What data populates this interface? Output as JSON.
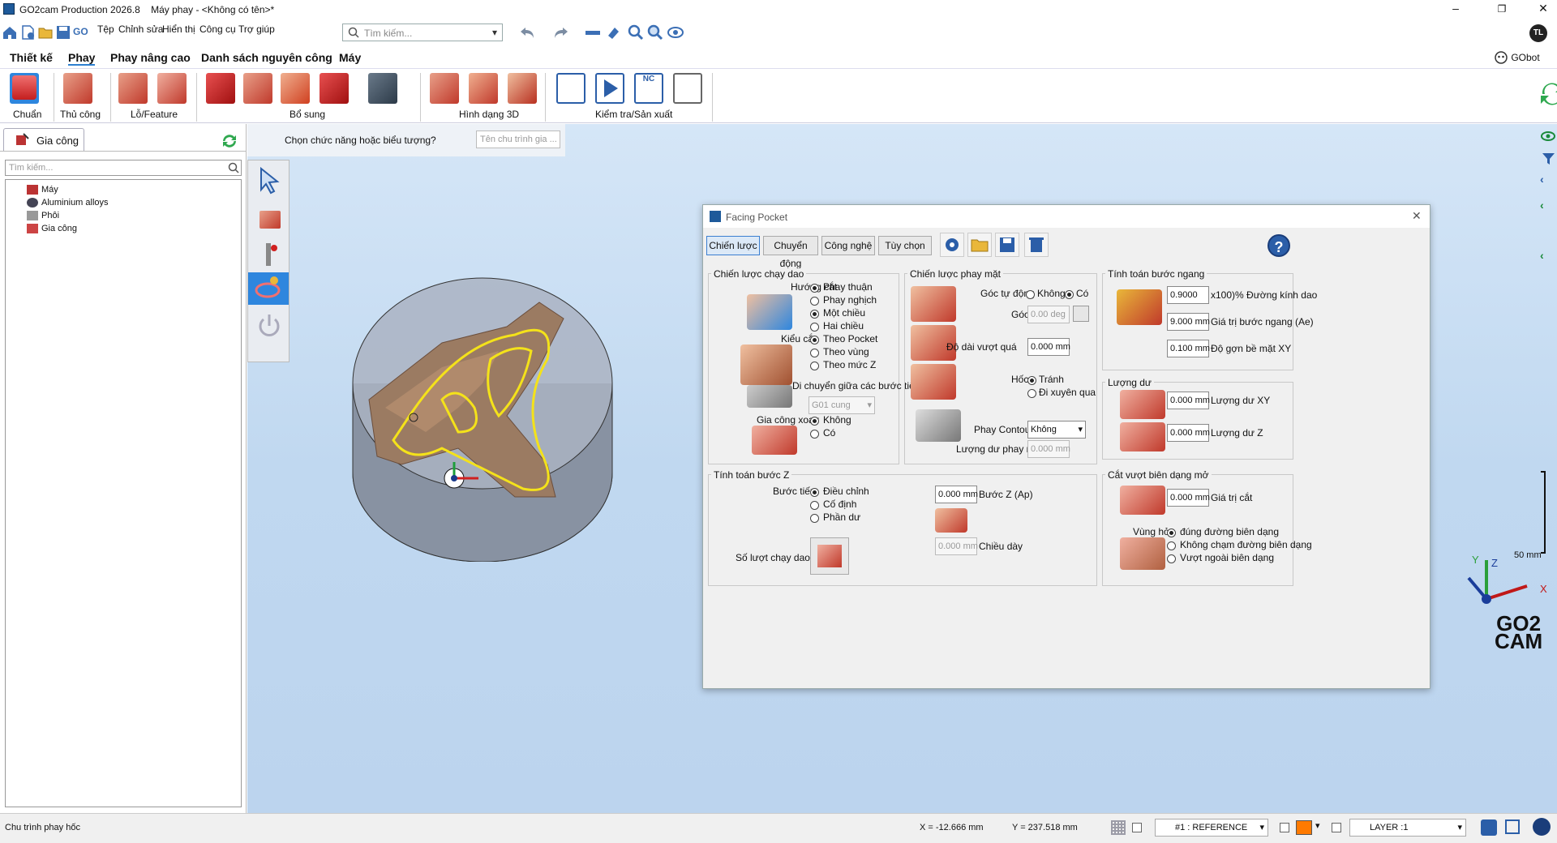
{
  "title_bar": {
    "app": "GO2cam Production 2026.8",
    "doc": "Máy phay - <Không có tên>*",
    "min": "–",
    "max": "❐",
    "close": "✕"
  },
  "menu": [
    "Tệp",
    "Chỉnh sửa",
    "Hiển thị",
    "Công cụ",
    "Trợ giúp"
  ],
  "search": {
    "placeholder": "Tìm kiếm..."
  },
  "user_initials": "TL",
  "go_label": "GO",
  "ribbon_tabs": [
    "Thiết kế",
    "Phay",
    "Phay nâng cao",
    "Danh sách nguyên công",
    "Máy"
  ],
  "gobot": "GObot",
  "ribbon_groups": [
    "Chuẩn",
    "Thủ công",
    "Lỗ/Feature",
    "Bổ sung",
    "Hình dạng 3D",
    "Kiểm tra/Sản xuất"
  ],
  "left_panel": {
    "tab": "Gia công",
    "search_placeholder": "Tìm kiếm...",
    "tree": [
      "Máy",
      "Aluminium alloys",
      "Phôi",
      "Gia công"
    ]
  },
  "hint": {
    "text": "Chọn chức năng hoặc biểu tượng?",
    "input_placeholder": "Tên chu trình gia ..."
  },
  "dialog": {
    "title": "Facing Pocket",
    "tabs": [
      "Chiến lược",
      "Chuyển động",
      "Công nghệ",
      "Tùy chọn"
    ],
    "g1": {
      "title": "Chiến lược chạy dao",
      "huong_cat": "Hướng cắt",
      "r1": [
        "Phay thuận",
        "Phay nghịch"
      ],
      "r2": [
        "Một chiều",
        "Hai chiều"
      ],
      "kieu_cat": "Kiểu cắt",
      "r3": [
        "Theo Pocket",
        "Theo vùng",
        "Theo mức Z"
      ],
      "di_chuyen": "Di chuyển giữa các bước tiến",
      "di_chuyen_val": "G01 cung",
      "gc_xoay": "Gia công xoay",
      "r4": [
        "Không",
        "Có"
      ]
    },
    "g2": {
      "title": "Chiến lược phay mặt",
      "goc_tu_dong": "Góc tự động",
      "r5": [
        "Không",
        "Có"
      ],
      "goc": "Góc",
      "goc_val": "0.00 deg",
      "do_dai": "Độ dài vượt quá",
      "do_dai_val": "0.000 mm",
      "hoc": "Hốc",
      "r6": [
        "Tránh",
        "Đi xuyên qua"
      ],
      "phay_contour": "Phay Contour",
      "phay_contour_val": "Không",
      "luong_du": "Lượng dư phay mặt",
      "luong_du_val": "0.000 mm"
    },
    "g3": {
      "title": "Tính toán bước ngang",
      "v1": "0.9000",
      "l1": "x100)% Đường kính dao",
      "v2": "9.000 mm",
      "l2": "Giá trị bước ngang (Ae)",
      "v3": "0.100 mm",
      "l3": "Độ gợn bề mặt XY"
    },
    "g4": {
      "title": "Lượng dư",
      "v1": "0.000 mm",
      "l1": "Lượng dư XY",
      "v2": "0.000 mm",
      "l2": "Lượng dư Z"
    },
    "g5": {
      "title": "Tính toán bước Z",
      "buoc_tien": "Bước tiến",
      "r7": [
        "Điều chỉnh",
        "Cố định",
        "Phần dư"
      ],
      "so_luot": "Số lượt chạy dao",
      "bz_val": "0.000 mm",
      "bz_lbl": "Bước Z (Ap)",
      "cd_val": "0.000 mm",
      "cd_lbl": "Chiều dày"
    },
    "g6": {
      "title": "Cắt vượt biên dạng mở",
      "v1": "0.000 mm",
      "l1": "Giá trị cắt",
      "vung_ho": "Vùng hở",
      "r8": [
        "đúng đường biên dạng",
        "Không chạm đường biên dạng",
        "Vượt ngoài biên dạng"
      ]
    }
  },
  "scale": "50 mm",
  "axes": {
    "x": "X",
    "y": "Y",
    "z": "Z"
  },
  "logo": [
    "GO2",
    "CAM"
  ],
  "status": {
    "left": "Chu trình phay hốc",
    "x": "X = -12.666 mm",
    "y": "Y = 237.518 mm",
    "ref": "#1 : REFERENCE",
    "layer": "LAYER :1"
  }
}
